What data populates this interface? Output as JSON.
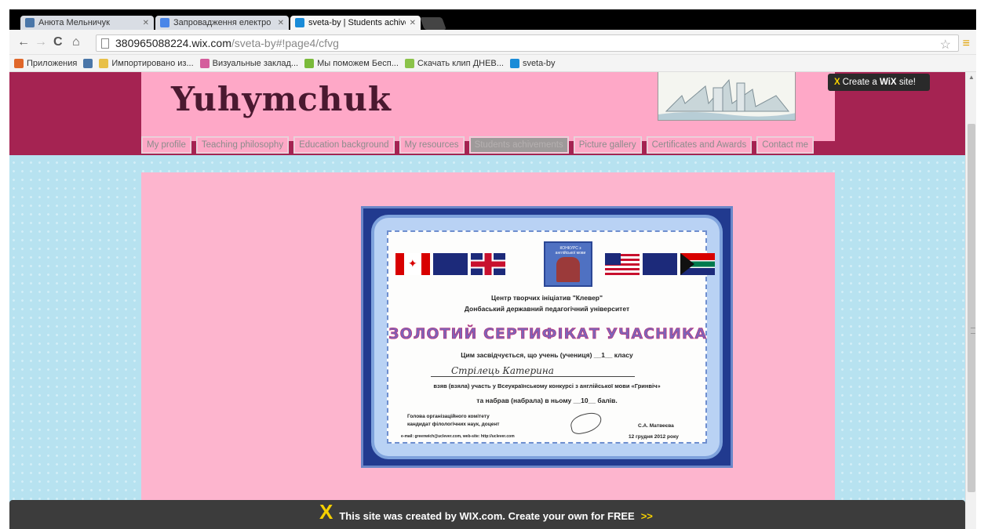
{
  "browser": {
    "tabs": [
      {
        "title": "Анюта Мельничук",
        "favicon_color": "#4a76a8"
      },
      {
        "title": "Запровадження електро",
        "favicon_color": "#4a86e8"
      },
      {
        "title": "sveta-by | Students achive",
        "favicon_color": "#1a8cd8"
      }
    ],
    "nav_back": "←",
    "nav_forward": "→",
    "nav_reload": "C",
    "nav_home": "⌂",
    "url_host": "380965088224.wix.com",
    "url_path": "/sveta-by#!page4/cfvg",
    "star_icon": "☆",
    "menu_icon": "≡",
    "bookmarks": [
      {
        "label": "Приложения",
        "icon": "apps-icon",
        "color": "#e0672a"
      },
      {
        "label": "",
        "icon": "vk-icon",
        "color": "#4a76a8"
      },
      {
        "label": "Импортировано из...",
        "icon": "folder-icon",
        "color": "#e8c048"
      },
      {
        "label": "Визуальные заклад...",
        "icon": "grid-icon",
        "color": "#d45d9c"
      },
      {
        "label": "Мы поможем Бесп...",
        "icon": "leaf-icon",
        "color": "#7aba3a"
      },
      {
        "label": "Скачать клип ДНЕВ...",
        "icon": "download-icon",
        "color": "#8bc34a"
      },
      {
        "label": "sveta-by",
        "icon": "wix-icon",
        "color": "#1a8cd8"
      }
    ]
  },
  "site": {
    "logo": "Yuhymchuk",
    "create_badge": {
      "prefix": "Create a",
      "brand": "WiX",
      "suffix": "site!"
    },
    "nav": [
      {
        "label": "My profile",
        "active": false
      },
      {
        "label": "Teaching philosophy",
        "active": false
      },
      {
        "label": "Education background",
        "active": false
      },
      {
        "label": "My resources",
        "active": false
      },
      {
        "label": "Students achivements",
        "active": true
      },
      {
        "label": "Picture gallery",
        "active": false
      },
      {
        "label": "Certificates and Awards",
        "active": false
      },
      {
        "label": "Contact me",
        "active": false
      }
    ],
    "colors": {
      "header": "#a52352",
      "pink": "#fea8c7",
      "content": "#fdb5ce",
      "background": "#b7e2f0"
    }
  },
  "certificate": {
    "org1": "Центр творчих ініціатив \"Клевер\"",
    "org2": "Донбаський державний педагогічний університет",
    "title": "ЗОЛОТИЙ СЕРТИФІКАТ УЧАСНИКА",
    "line1": "Цим засвідчується, що учень (учениця)  __1__  класу",
    "name": "Стрілець   Катерина",
    "line2": "взяв (взяла) участь у Всеукраїнському конкурсі з англійської мови «Гринвіч»",
    "line3": "та набрав (набрала) в ньому  __10__  балів.",
    "sign_left1": "Голова організаційного комітету",
    "sign_left2": "кандидат філологічних наук, доцент",
    "sign_right": "С.А. Матвеєва",
    "email": "e-mail: greenwich@uclever.com, web-site: http://uclever.com",
    "date": "12 грудня 2012 року",
    "logo_text": "КОНКУРС з англійської мови"
  },
  "footer": {
    "text": "This site was created by WIX.com. Create your own for FREE",
    "arrows": ">>"
  }
}
